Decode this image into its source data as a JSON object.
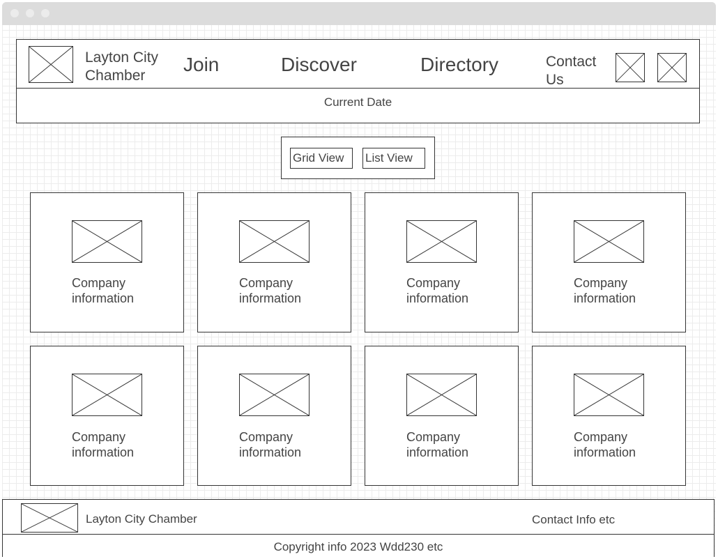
{
  "header": {
    "brand_line1": "Layton City",
    "brand_line2": "Chamber",
    "nav": [
      "Join",
      "Discover",
      "Directory"
    ],
    "contact_line1": "Contact",
    "contact_line2": "Us",
    "current_date": "Current Date"
  },
  "view_toggle": {
    "grid_label": "Grid View",
    "list_label": "List View"
  },
  "cards": [
    {
      "line1": "Company",
      "line2": "information"
    },
    {
      "line1": "Company",
      "line2": "information"
    },
    {
      "line1": "Company",
      "line2": "information"
    },
    {
      "line1": "Company",
      "line2": "information"
    },
    {
      "line1": "Company",
      "line2": "information"
    },
    {
      "line1": "Company",
      "line2": "information"
    },
    {
      "line1": "Company",
      "line2": "information"
    },
    {
      "line1": "Company",
      "line2": "information"
    }
  ],
  "footer": {
    "brand": "Layton City Chamber",
    "contact": "Contact Info etc",
    "copyright": "Copyright info 2023 Wdd230 etc"
  },
  "icons": [
    "image-placeholder-icon"
  ]
}
